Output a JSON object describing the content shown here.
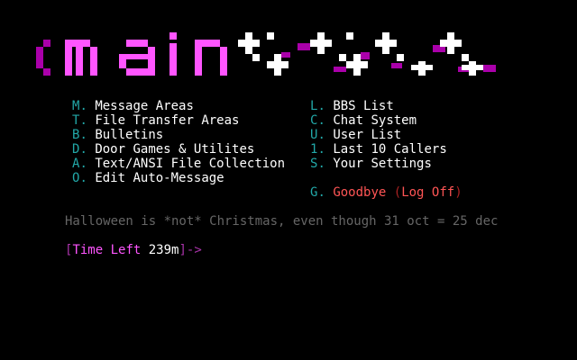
{
  "banner": {
    "text": "main",
    "colors": {
      "primary": "#ff55ff",
      "shade": "#aa00aa",
      "pattern": "#ffffff"
    }
  },
  "menu": {
    "left": [
      {
        "key": "M",
        "label": "Message Areas"
      },
      {
        "key": "T",
        "label": "File Transfer Areas"
      },
      {
        "key": "B",
        "label": "Bulletins"
      },
      {
        "key": "D",
        "label": "Door Games & Utilites"
      },
      {
        "key": "A",
        "label": "Text/ANSI File Collection"
      },
      {
        "key": "O",
        "label": "Edit Auto-Message"
      }
    ],
    "right": [
      {
        "key": "L",
        "label": "BBS List"
      },
      {
        "key": "C",
        "label": "Chat System"
      },
      {
        "key": "U",
        "label": "User List"
      },
      {
        "key": "1",
        "label": "Last 10 Callers"
      },
      {
        "key": "S",
        "label": "Your Settings"
      }
    ],
    "goodbye": {
      "key": "G",
      "label": "Goodbye",
      "sublabel": "Log Off"
    },
    "separator": ".",
    "colors": {
      "key": "#22a8a8",
      "label": "#ffffff",
      "goodbye": "#ff5555"
    }
  },
  "auto_message": "Halloween is *not* Christmas, even though 31 oct = 25 dec",
  "prompt": {
    "open": "[",
    "label": "Time Left ",
    "value": "239m",
    "close": "]",
    "arrow": "->"
  }
}
